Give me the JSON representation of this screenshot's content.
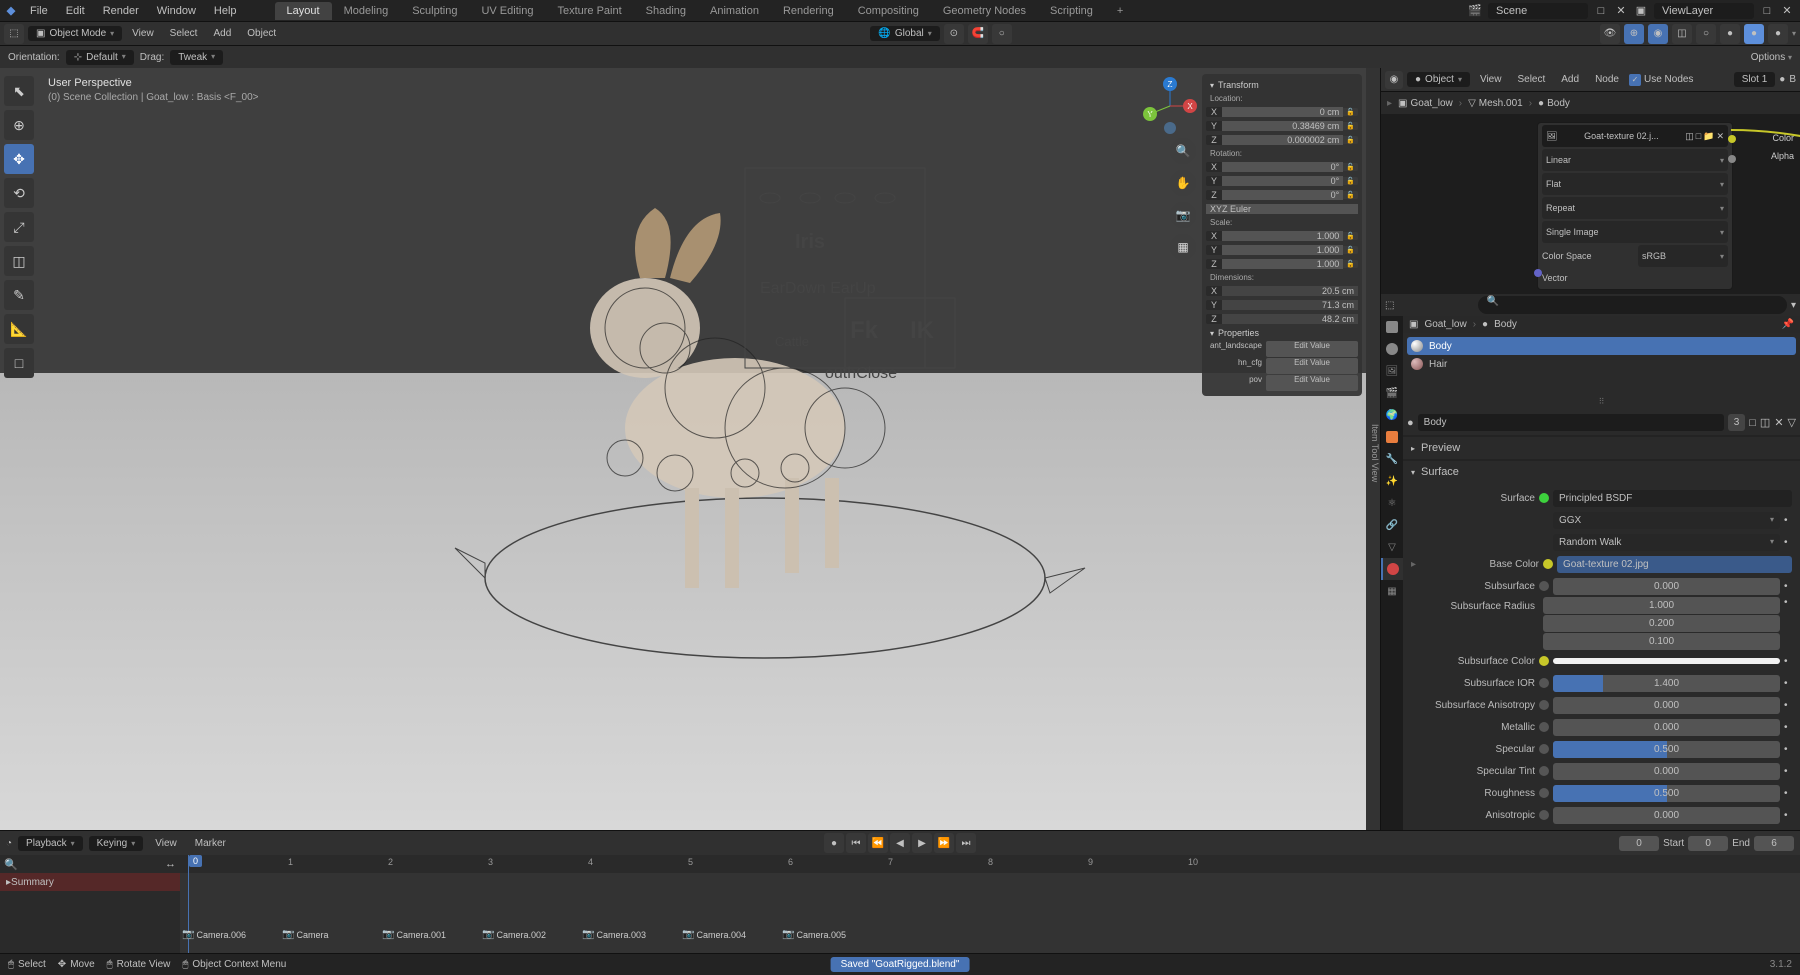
{
  "topMenu": [
    "File",
    "Edit",
    "Render",
    "Window",
    "Help"
  ],
  "workspaceTabs": [
    "Layout",
    "Modeling",
    "Sculpting",
    "UV Editing",
    "Texture Paint",
    "Shading",
    "Animation",
    "Rendering",
    "Compositing",
    "Geometry Nodes",
    "Scripting"
  ],
  "activeWorkspace": "Layout",
  "sceneField": "Scene",
  "viewLayerField": "ViewLayer",
  "modeSelector": "Object Mode",
  "viewMenu": [
    "View",
    "Select",
    "Add",
    "Object"
  ],
  "orientation": "Global",
  "orientationRow": {
    "label": "Orientation:",
    "default": "Default",
    "dragLabel": "Drag:",
    "tweak": "Tweak",
    "options": "Options"
  },
  "viewportLabel": {
    "title": "User Perspective",
    "sub": "(0) Scene Collection | Goat_low : Basis <F_00>"
  },
  "npanel": {
    "transform": "Transform",
    "location": "Location:",
    "loc": [
      {
        "a": "X",
        "v": "0 cm"
      },
      {
        "a": "Y",
        "v": "0.38469 cm"
      },
      {
        "a": "Z",
        "v": "0.000002 cm"
      }
    ],
    "rotation": "Rotation:",
    "rot": [
      {
        "a": "X",
        "v": "0°"
      },
      {
        "a": "Y",
        "v": "0°"
      },
      {
        "a": "Z",
        "v": "0°"
      }
    ],
    "rotMode": "XYZ Euler",
    "scale": "Scale:",
    "scl": [
      {
        "a": "X",
        "v": "1.000"
      },
      {
        "a": "Y",
        "v": "1.000"
      },
      {
        "a": "Z",
        "v": "1.000"
      }
    ],
    "dimensions": "Dimensions:",
    "dim": [
      {
        "a": "X",
        "v": "20.5 cm"
      },
      {
        "a": "Y",
        "v": "71.3 cm"
      },
      {
        "a": "Z",
        "v": "48.2 cm"
      }
    ],
    "properties": "Properties",
    "props": [
      {
        "l": "ant_landscape",
        "v": "Edit Value"
      },
      {
        "l": "hn_cfg",
        "v": "Edit Value"
      },
      {
        "l": "pov",
        "v": "Edit Value"
      }
    ]
  },
  "rightRibbon": "Item  Tool  View",
  "shaderBar": {
    "type": "Object",
    "menu": [
      "View",
      "Select",
      "Add",
      "Node"
    ],
    "useNodes": "Use Nodes",
    "slot": "Slot 1",
    "mat": "B"
  },
  "shaderBreadcrumb": [
    "Goat_low",
    "Mesh.001",
    "Body"
  ],
  "imageNode": {
    "title": "Goat-texture 02.j...",
    "outColor": "Color",
    "outAlpha": "Alpha",
    "interp": "Linear",
    "proj": "Flat",
    "ext": "Repeat",
    "source": "Single Image",
    "csLabel": "Color Space",
    "cs": "sRGB",
    "vector": "Vector"
  },
  "matBreadcrumb": [
    "Goat_low",
    "Body"
  ],
  "matSlots": [
    "Body",
    "Hair"
  ],
  "matField": {
    "name": "Body",
    "users": "3"
  },
  "sections": {
    "preview": "Preview",
    "surface": "Surface"
  },
  "surfaceProps": {
    "surfaceLabel": "Surface",
    "surfaceVal": "Principled BSDF",
    "dist": "GGX",
    "sssMethod": "Random Walk",
    "baseColorLabel": "Base Color",
    "baseColorVal": "Goat-texture 02.jpg",
    "rows": [
      {
        "l": "Subsurface",
        "v": "0.000",
        "bar": 0
      },
      {
        "l": "Subsurface Radius",
        "stack": [
          "1.000",
          "0.200",
          "0.100"
        ],
        "dot": "p"
      },
      {
        "l": "Subsurface Color",
        "color": true,
        "dot": "y"
      },
      {
        "l": "Subsurface IOR",
        "v": "1.400",
        "bar": 22
      },
      {
        "l": "Subsurface Anisotropy",
        "v": "0.000",
        "bar": 0
      },
      {
        "l": "Metallic",
        "v": "0.000",
        "bar": 0
      },
      {
        "l": "Specular",
        "v": "0.500",
        "bar": 50
      },
      {
        "l": "Specular Tint",
        "v": "0.000",
        "bar": 0
      },
      {
        "l": "Roughness",
        "v": "0.500",
        "bar": 50
      },
      {
        "l": "Anisotropic",
        "v": "0.000",
        "bar": 0
      }
    ]
  },
  "timeline": {
    "playback": "Playback",
    "keying": "Keying",
    "view": "View",
    "marker": "Marker",
    "frame": "0",
    "start": "Start",
    "startV": "0",
    "end": "End",
    "endV": "6",
    "summary": "Summary",
    "ticks": [
      "0",
      "1",
      "2",
      "3",
      "4",
      "5",
      "6",
      "7",
      "8",
      "9",
      "10"
    ],
    "cursor": "0",
    "cameras": [
      "Camera.006",
      "Camera",
      "Camera.001",
      "Camera.002",
      "Camera.003",
      "Camera.004",
      "Camera.005"
    ]
  },
  "status": {
    "select": "Select",
    "move": "Move",
    "rotate": "Rotate View",
    "menu": "Object Context Menu",
    "saved": "Saved \"GoatRigged.blend\"",
    "version": "3.1.2"
  }
}
